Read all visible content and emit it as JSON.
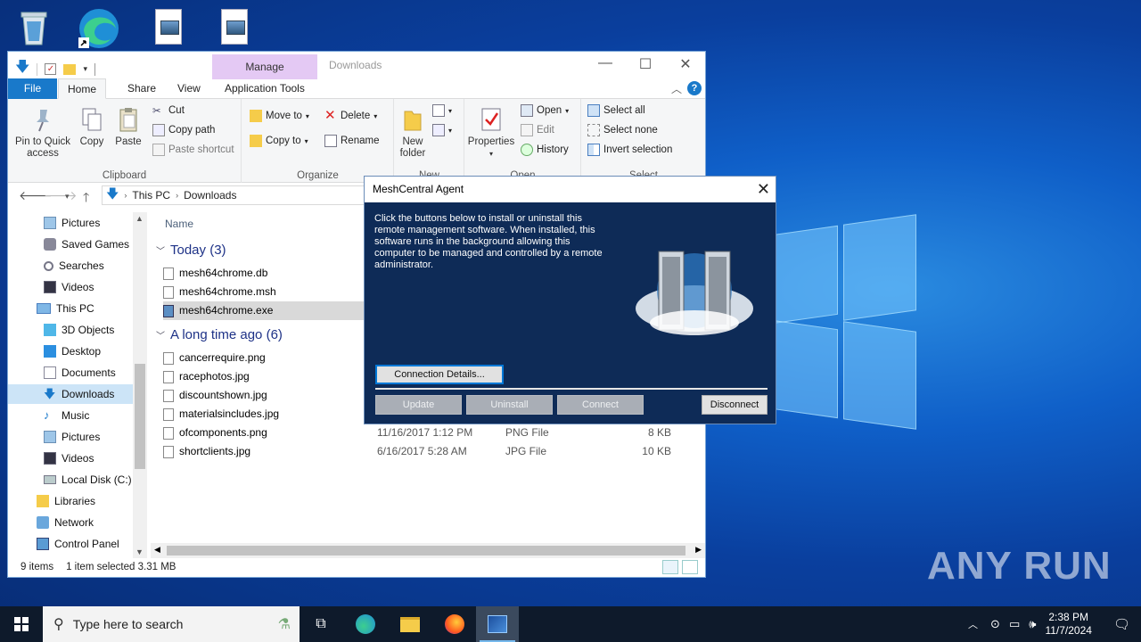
{
  "explorer": {
    "window_title": "Downloads",
    "manage_tab": "Manage",
    "tabs": [
      "File",
      "Home",
      "Share",
      "View",
      "Application Tools"
    ],
    "help": "?",
    "ribbon": {
      "clipboard": {
        "label": "Clipboard",
        "pin": "Pin to Quick access",
        "copy": "Copy",
        "paste": "Paste",
        "cut": "Cut",
        "copy_path": "Copy path",
        "paste_shortcut": "Paste shortcut"
      },
      "organize": {
        "label": "Organize",
        "move_to": "Move to",
        "copy_to": "Copy to",
        "delete": "Delete",
        "rename": "Rename"
      },
      "new": {
        "label": "New",
        "new_folder": "New folder"
      },
      "open": {
        "label": "Open",
        "properties": "Properties",
        "open": "Open",
        "edit": "Edit",
        "history": "History"
      },
      "select": {
        "label": "Select",
        "select_all": "Select all",
        "select_none": "Select none",
        "invert": "Invert selection"
      }
    },
    "address": {
      "this_pc": "This PC",
      "folder": "Downloads"
    },
    "nav": [
      "Pictures",
      "Saved Games",
      "Searches",
      "Videos",
      "This PC",
      "3D Objects",
      "Desktop",
      "Documents",
      "Downloads",
      "Music",
      "Pictures",
      "Videos",
      "Local Disk (C:)",
      "Libraries",
      "Network",
      "Control Panel"
    ],
    "column_name": "Name",
    "group_today": "Today (3)",
    "group_long": "A long time ago (6)",
    "files_today": [
      {
        "name": "mesh64chrome.db"
      },
      {
        "name": "mesh64chrome.msh"
      },
      {
        "name": "mesh64chrome.exe"
      }
    ],
    "files_long": [
      {
        "name": "cancerrequire.png",
        "date": "",
        "type": "",
        "size": ""
      },
      {
        "name": "racephotos.jpg",
        "date": "",
        "type": "",
        "size": ""
      },
      {
        "name": "discountshown.jpg",
        "date": "",
        "type": "",
        "size": ""
      },
      {
        "name": "materialsincludes.jpg",
        "date": "",
        "type": "",
        "size": ""
      },
      {
        "name": "ofcomponents.png",
        "date": "11/16/2017 1:12 PM",
        "type": "PNG File",
        "size": "8 KB"
      },
      {
        "name": "shortclients.jpg",
        "date": "6/16/2017 5:28 AM",
        "type": "JPG File",
        "size": "10 KB"
      }
    ],
    "status": {
      "count": "9 items",
      "selected": "1 item selected  3.31 MB"
    }
  },
  "dialog": {
    "title": "MeshCentral Agent",
    "text": "Click the buttons below to install or uninstall this remote management software. When installed, this software runs in the background allowing this computer to be managed and controlled by a remote administrator.",
    "connection_details": "Connection Details...",
    "update": "Update",
    "uninstall": "Uninstall",
    "connect": "Connect",
    "disconnect": "Disconnect"
  },
  "taskbar": {
    "search_placeholder": "Type here to search",
    "time": "2:38 PM",
    "date": "11/7/2024"
  },
  "watermark": "ANY RUN",
  "colors": {
    "accent": "#1979ca",
    "dialog_bg": "#0e2b57",
    "manage_tab": "#e4c9f4",
    "selected_row": "#cce4f7"
  }
}
